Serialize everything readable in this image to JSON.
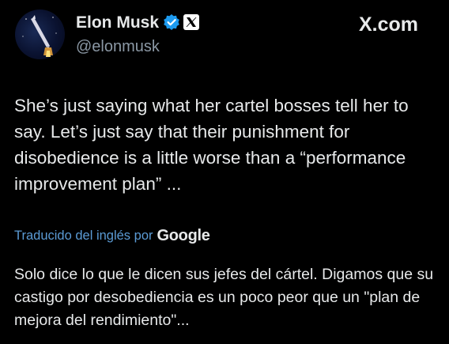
{
  "header": {
    "display_name": "Elon Musk",
    "handle": "@elonmusk",
    "verified_icon": "verified-badge-icon",
    "affiliation_icon": "x-logo-icon",
    "brand": "X.com"
  },
  "tweet": {
    "text": "She’s just saying what her cartel bosses tell her to say. Let’s just say that their punishment for disobedience is a little worse than a “performance improvement plan” ..."
  },
  "translation": {
    "label": "Traducido del inglés por",
    "provider": "Google",
    "text": "Solo dice lo que le dicen sus jefes del cártel. Digamos que su castigo por desobediencia es un poco peor que un \"plan de mejora del rendimiento\"..."
  },
  "colors": {
    "background": "#000000",
    "text": "#e7e9ea",
    "secondary_text": "#8b98a5",
    "link": "#5b9bd5",
    "verified_blue": "#1d9bf0"
  }
}
